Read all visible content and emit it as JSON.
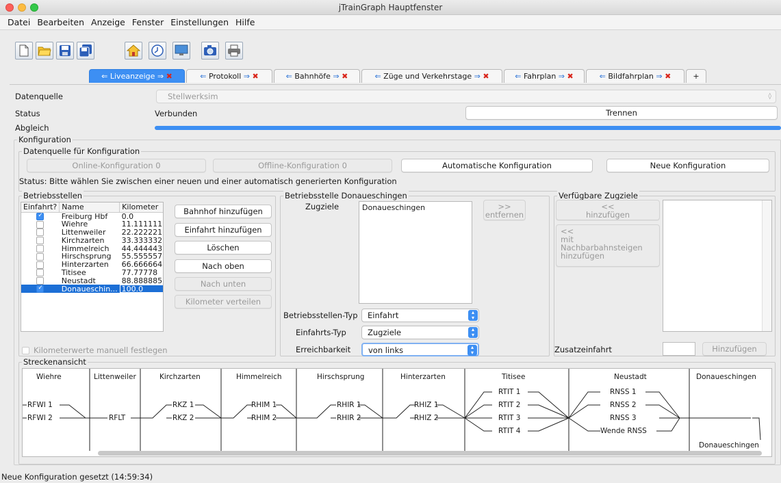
{
  "window": {
    "title": "jTrainGraph Hauptfenster"
  },
  "menu": [
    "Datei",
    "Bearbeiten",
    "Anzeige",
    "Fenster",
    "Einstellungen",
    "Hilfe"
  ],
  "toolbar": [
    "new-file-icon",
    "open-folder-icon",
    "save-icon",
    "save-as-icon",
    "home-icon",
    "clock-icon",
    "monitor-icon",
    "camera-icon",
    "print-icon"
  ],
  "tabs": [
    {
      "label": "Liveanzeige",
      "active": true
    },
    {
      "label": "Protokoll",
      "active": false
    },
    {
      "label": "Bahnhöfe",
      "active": false
    },
    {
      "label": "Züge und Verkehrstage",
      "active": false
    },
    {
      "label": "Fahrplan",
      "active": false
    },
    {
      "label": "Bildfahrplan",
      "active": false
    }
  ],
  "tab_add": "+",
  "live": {
    "datasource_label": "Datenquelle",
    "datasource_value": "Stellwerksim",
    "status_label": "Status",
    "status_value": "Verbunden",
    "disconnect": "Trennen",
    "sync_label": "Abgleich",
    "sync_progress": 1.0
  },
  "config": {
    "legend": "Konfiguration",
    "source_legend": "Datenquelle für Konfiguration",
    "online": "Online-Konfiguration 0",
    "offline": "Offline-Konfiguration 0",
    "auto": "Automatische Konfiguration",
    "new": "Neue Konfiguration",
    "status": "Status: Bitte wählen Sie zwischen einer neuen und einer automatisch generierten Konfiguration"
  },
  "betriebsstellen": {
    "legend": "Betriebsstellen",
    "columns": [
      "Einfahrt?",
      "Name",
      "Kilometer"
    ],
    "rows": [
      {
        "check": true,
        "name": "Freiburg Hbf",
        "km": "0.0"
      },
      {
        "check": false,
        "name": "Wiehre",
        "km": "11.111111"
      },
      {
        "check": false,
        "name": "Littenweiler",
        "km": "22.222221"
      },
      {
        "check": false,
        "name": "Kirchzarten",
        "km": "33.333332"
      },
      {
        "check": false,
        "name": "Himmelreich",
        "km": "44.444443"
      },
      {
        "check": false,
        "name": "Hirschsprung",
        "km": "55.555557"
      },
      {
        "check": false,
        "name": "Hinterzarten",
        "km": "66.666664"
      },
      {
        "check": false,
        "name": "Titisee",
        "km": "77.77778"
      },
      {
        "check": false,
        "name": "Neustadt",
        "km": "88.888885"
      },
      {
        "check": true,
        "name": "Donaueschin...",
        "km": "100.0",
        "selected": true
      }
    ],
    "buttons": [
      "Bahnhof hinzufügen",
      "Einfahrt hinzufügen",
      "Löschen",
      "Nach oben",
      "Nach unten",
      "Kilometer verteilen"
    ],
    "manual_km": "Kilometerwerte manuell festlegen"
  },
  "detail": {
    "legend": "Betriebsstelle Donaueschingen",
    "zugziele_label": "Zugziele",
    "zugziele": [
      "Donaueschingen"
    ],
    "remove": [
      ">>",
      "entfernen"
    ],
    "typ_label": "Betriebsstellen-Typ",
    "typ_value": "Einfahrt",
    "einfahrt_label": "Einfahrts-Typ",
    "einfahrt_value": "Zugziele",
    "erreich_label": "Erreichbarkeit",
    "erreich_value": "von links"
  },
  "verfuegbar": {
    "legend": "Verfügbare Zugziele",
    "add": [
      "<<",
      "hinzufügen"
    ],
    "add_neighbor": [
      "<<",
      "mit",
      "Nachbarbahnsteigen",
      "hinzufügen"
    ],
    "zusatz_label": "Zusatzeinfahrt",
    "zusatz_value": "",
    "zusatz_button": "Hinzufügen"
  },
  "strecke": {
    "legend": "Streckenansicht",
    "stations": [
      "Wiehre",
      "Littenweiler",
      "Kirchzarten",
      "Himmelreich",
      "Hirschsprung",
      "Hinterzarten",
      "Titisee",
      "Neustadt",
      "Donaueschingen"
    ],
    "tracks": [
      "RFWI 1",
      "RFWI 2",
      "RFLT",
      "RKZ 1",
      "RKZ 2",
      "RHIM 1",
      "RHIM 2",
      "RHIR 1",
      "RHIR 2",
      "RHIZ 1",
      "RHIZ 2",
      "RTIT 1",
      "RTIT 2",
      "RTIT 3",
      "RTIT 4",
      "RNSS 1",
      "RNSS 2",
      "RNSS 3",
      "Wende RNSS",
      "Donaueschingen"
    ]
  },
  "statusbar": "Neue Konfiguration gesetzt (14:59:34)"
}
